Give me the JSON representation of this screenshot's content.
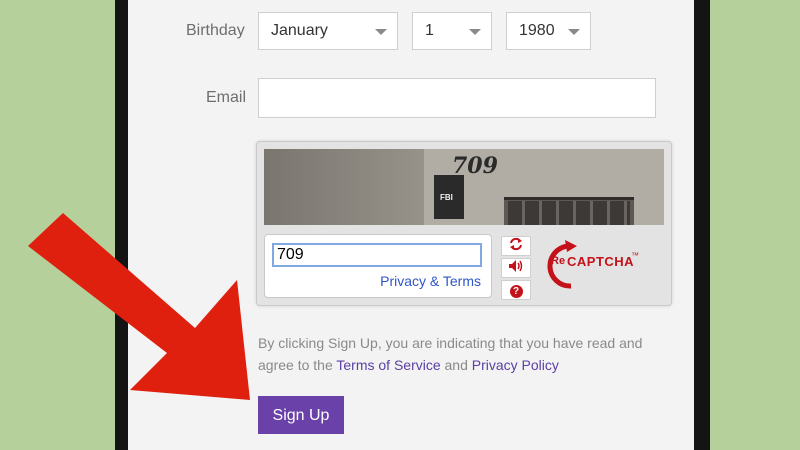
{
  "form": {
    "birthday_label": "Birthday",
    "birthday_month": "January",
    "birthday_day": "1",
    "birthday_year": "1980",
    "email_label": "Email",
    "email_value": ""
  },
  "captcha": {
    "image_text": "709",
    "image_sign": "FBI",
    "answer_value": "709",
    "privacy_terms": "Privacy & Terms",
    "refresh_icon": "refresh-icon",
    "audio_icon": "audio-icon",
    "help_icon": "help-icon",
    "help_symbol": "?",
    "logo_prefix": "Re",
    "logo_text": "CAPTCHA",
    "logo_tm": "™"
  },
  "legal": {
    "before": "By clicking Sign Up, you are indicating that you have read and agree to the ",
    "terms_link": "Terms of Service",
    "middle": " and ",
    "privacy_link": "Privacy Policy"
  },
  "signup_label": "Sign Up",
  "colors": {
    "accent": "#6a41a8",
    "arrow": "#e0200f",
    "link": "#5b3fa5"
  }
}
